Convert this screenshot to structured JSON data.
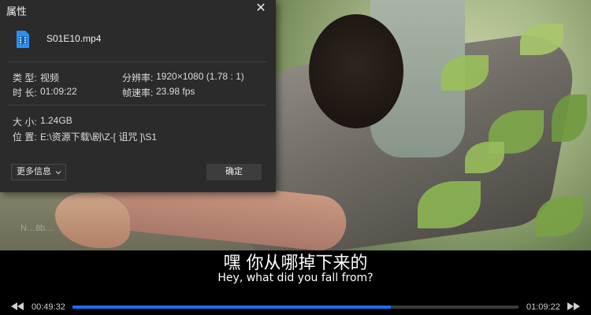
{
  "dialog": {
    "title": "属性",
    "file_name": "S01E10.mp4",
    "type_label": "类 型:",
    "type_value": "视频",
    "duration_label": "时 长:",
    "duration_value": "01:09:22",
    "resolution_label": "分辨率:",
    "resolution_value": "1920×1080 (1.78 : 1)",
    "framerate_label": "帧速率:",
    "framerate_value": "23.98 fps",
    "size_label": "大 小:",
    "size_value": "1.24GB",
    "location_label": "位 置:",
    "location_value": "E:\\资源下载\\剧\\Z-[ 诅咒 ]\\S1",
    "more_info_button": "更多信息",
    "ok_button": "确定"
  },
  "subtitles": {
    "chinese": "嘿  你从哪掉下来的",
    "english": "Hey, what did you fall from?"
  },
  "player": {
    "current_time": "00:49:32",
    "total_time": "01:09:22",
    "progress": 0.714
  },
  "watermark": "N…8b…",
  "colors": {
    "accent": "#1b6ff0",
    "dialog_bg": "#2b2b2b",
    "file_icon": "#2b8ef5"
  },
  "icons": {
    "close": "close-icon",
    "file": "video-file-icon",
    "prev": "previous-icon",
    "next": "next-icon",
    "caret": "chevron-down-icon"
  }
}
